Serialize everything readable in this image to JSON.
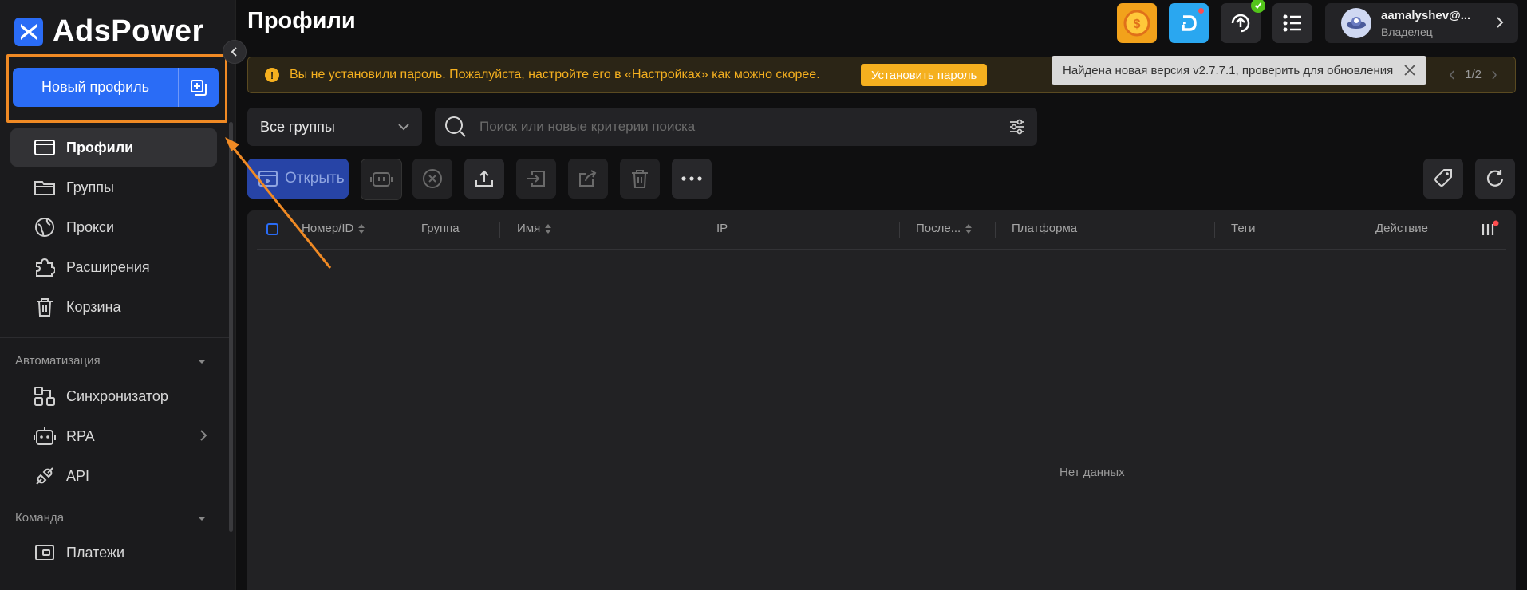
{
  "app": {
    "logo_text": "AdsPower"
  },
  "sidebar": {
    "new_profile_label": "Новый профиль",
    "items": [
      {
        "label": "Профили",
        "icon": "browser-window-icon",
        "active": true
      },
      {
        "label": "Группы",
        "icon": "folder-icon"
      },
      {
        "label": "Прокси",
        "icon": "globe-icon"
      },
      {
        "label": "Расширения",
        "icon": "puzzle-icon"
      },
      {
        "label": "Корзина",
        "icon": "trash-icon"
      }
    ],
    "automation_title": "Автоматизация",
    "automation_items": [
      {
        "label": "Синхронизатор",
        "icon": "sync-icon"
      },
      {
        "label": "RPA",
        "icon": "robot-icon"
      },
      {
        "label": "API",
        "icon": "plug-icon"
      }
    ],
    "team_title": "Команда",
    "team_items": [
      {
        "label": "Платежи",
        "icon": "wallet-icon"
      }
    ]
  },
  "header": {
    "page_title": "Профили",
    "user": {
      "name": "aamalyshev@...",
      "role": "Владелец"
    }
  },
  "warning": {
    "text": "Вы не установили пароль. Пожалуйста, настройте его в «Настройках» как можно скорее.",
    "button": "Установить пароль",
    "pager": "1/2"
  },
  "tooltip": {
    "text": "Найдена новая версия v2.7.7.1, проверить для обновления"
  },
  "filters": {
    "group_select": "Все группы",
    "search_placeholder": "Поиск или новые критерии поиска"
  },
  "toolbar": {
    "open_label": "Открыть"
  },
  "table": {
    "columns": [
      "Номер/ID",
      "Группа",
      "Имя",
      "IP",
      "После...",
      "Платформа",
      "Теги",
      "Действие"
    ],
    "empty_text": "Нет данных"
  },
  "colors": {
    "accent": "#2a6cf6",
    "highlight": "#f08a24",
    "warning": "#f5b01f"
  }
}
